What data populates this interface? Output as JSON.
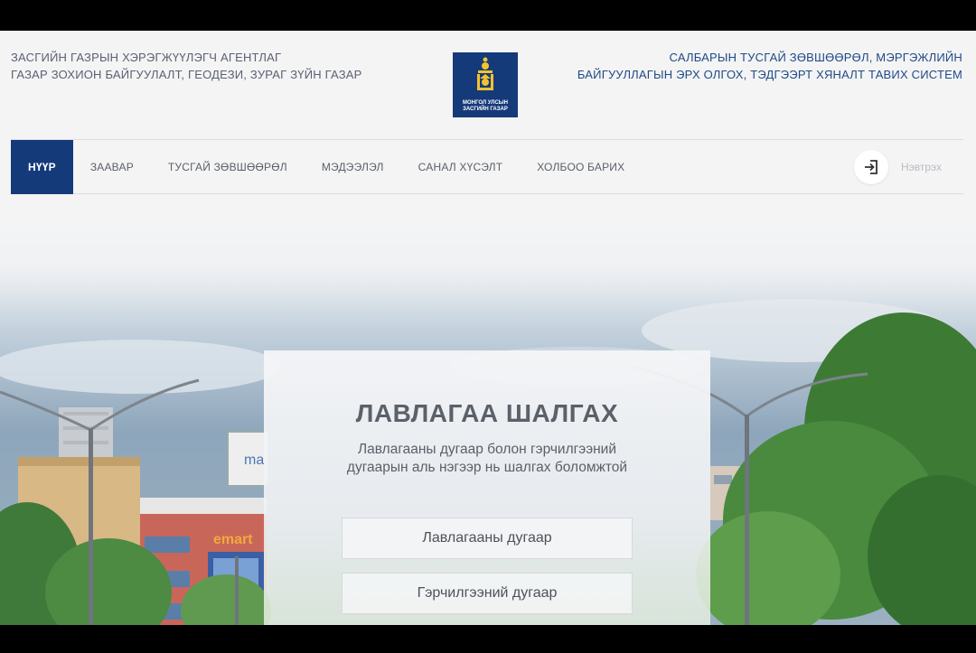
{
  "header": {
    "agency_line1": "ЗАСГИЙН ГАЗРЫН ХЭРЭГЖҮҮЛЭГЧ АГЕНТЛАГ",
    "agency_line2": "ГАЗАР ЗОХИОН БАЙГУУЛАЛТ, ГЕОДЕЗИ, ЗУРАГ ЗҮЙН ГАЗАР",
    "emblem_line1": "МОНГОЛ УЛСЫН",
    "emblem_line2": "ЗАСГИЙН ГАЗАР",
    "system_line1": "САЛБАРЫН ТУСГАЙ ЗӨВШӨӨРӨЛ, МЭРГЭЖЛИЙН",
    "system_line2": "БАЙГУУЛЛАГЫН ЭРХ ОЛГОХ, ТЭДГЭЭРТ ХЯНАЛТ ТАВИХ СИСТЕМ"
  },
  "nav": {
    "items": [
      {
        "label": "НҮҮР",
        "active": true
      },
      {
        "label": "ЗААВАР"
      },
      {
        "label": "ТУСГАЙ ЗӨВШӨӨРӨЛ"
      },
      {
        "label": "МЭДЭЭЛЭЛ"
      },
      {
        "label": "САНАЛ ХҮСЭЛТ"
      },
      {
        "label": "ХОЛБОО БАРИХ"
      }
    ],
    "login_label": "Нэвтрэх"
  },
  "hero": {
    "billboard_text": "ma",
    "store_sign": "emart"
  },
  "lookup": {
    "title": "ЛАВЛАГАА ШАЛГАХ",
    "subtitle_line1": "Лавлагааны дугаар болон гэрчилгээний",
    "subtitle_line2": "дугаарын аль нэгээр нь шалгах боломжтой",
    "reference_placeholder": "Лавлагааны дугаар",
    "certificate_placeholder": "Гэрчилгээний дугаар"
  },
  "colors": {
    "primary": "#153a7a",
    "emblem_gold": "#f2c230",
    "system_text": "#1f4a86"
  }
}
